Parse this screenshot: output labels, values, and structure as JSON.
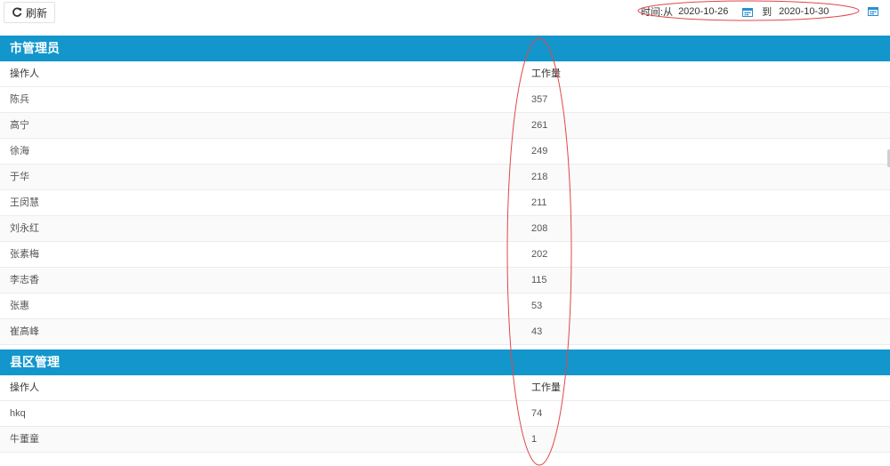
{
  "toolbar": {
    "refresh_label": "刷新",
    "date_from_label": "时间:从",
    "date_from": "2020-10-26",
    "date_to_label": "到",
    "date_to": "2020-10-30"
  },
  "sections": [
    {
      "title": "市管理员",
      "columns": [
        "操作人",
        "工作量"
      ],
      "rows": [
        {
          "name": "陈兵",
          "value": "357"
        },
        {
          "name": "高宁",
          "value": "261"
        },
        {
          "name": "徐海",
          "value": "249"
        },
        {
          "name": "于华",
          "value": "218"
        },
        {
          "name": "王闵慧",
          "value": "211"
        },
        {
          "name": "刘永红",
          "value": "208"
        },
        {
          "name": "张素梅",
          "value": "202"
        },
        {
          "name": "李志香",
          "value": "115"
        },
        {
          "name": "张惠",
          "value": "53"
        },
        {
          "name": "崔高峰",
          "value": "43"
        }
      ]
    },
    {
      "title": "县区管理",
      "columns": [
        "操作人",
        "工作量"
      ],
      "rows": [
        {
          "name": "hkq",
          "value": "74"
        },
        {
          "name": "牛董童",
          "value": "1"
        }
      ]
    }
  ],
  "colors": {
    "header_bg": "#1296cb",
    "annotation": "#e0474c"
  },
  "icons": {
    "refresh": "refresh-icon",
    "calendar": "calendar-icon"
  }
}
